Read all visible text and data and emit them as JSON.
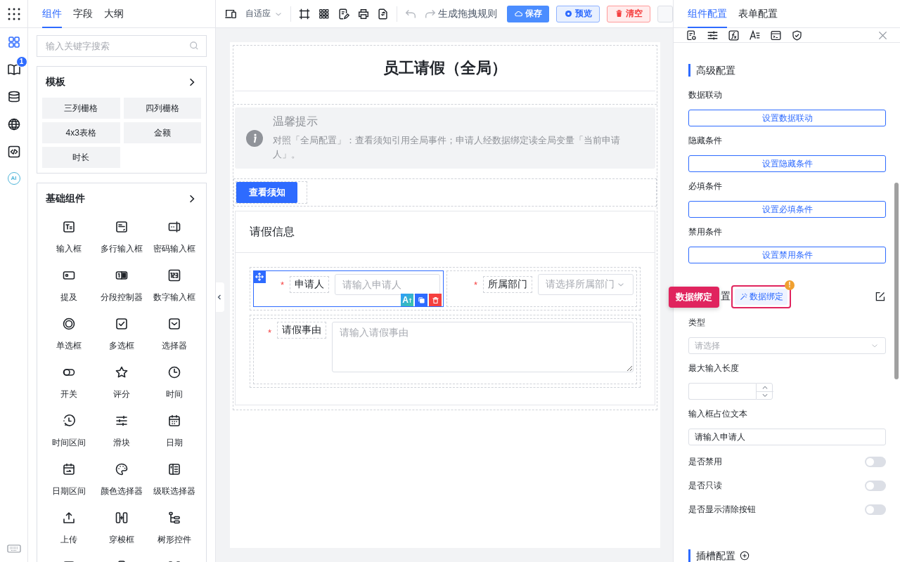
{
  "rail": {
    "items": [
      {
        "kind": "grid",
        "selected": true
      },
      {
        "kind": "book",
        "selected": false,
        "badge": "1"
      },
      {
        "kind": "database",
        "selected": false
      },
      {
        "kind": "globe",
        "selected": false
      },
      {
        "kind": "code",
        "selected": false
      },
      {
        "kind": "ai",
        "selected": false,
        "text": "AI"
      }
    ]
  },
  "left_panel": {
    "tabs": [
      {
        "label": "组件",
        "selected": true
      },
      {
        "label": "字段",
        "selected": false
      },
      {
        "label": "大纲",
        "selected": false
      }
    ],
    "search": {
      "placeholder": "输入关键字搜索"
    },
    "templates": {
      "title": "模板",
      "items": [
        "三列栅格",
        "四列栅格",
        "4x3表格",
        "金额",
        "时长"
      ]
    },
    "basic": {
      "title": "基础组件",
      "items": [
        {
          "label": "输入框",
          "kind": "input"
        },
        {
          "label": "多行输入框",
          "kind": "textarea"
        },
        {
          "label": "密码输入框",
          "kind": "password"
        },
        {
          "label": "提及",
          "kind": "mention"
        },
        {
          "label": "分段控制器",
          "kind": "segmented"
        },
        {
          "label": "数字输入框",
          "kind": "number"
        },
        {
          "label": "单选框",
          "kind": "radio"
        },
        {
          "label": "多选框",
          "kind": "checkbox"
        },
        {
          "label": "选择器",
          "kind": "select"
        },
        {
          "label": "开关",
          "kind": "switch"
        },
        {
          "label": "评分",
          "kind": "rate"
        },
        {
          "label": "时间",
          "kind": "time"
        },
        {
          "label": "时间区间",
          "kind": "timerange"
        },
        {
          "label": "滑块",
          "kind": "slider"
        },
        {
          "label": "日期",
          "kind": "date"
        },
        {
          "label": "日期区间",
          "kind": "daterange"
        },
        {
          "label": "颜色选择器",
          "kind": "palette"
        },
        {
          "label": "级联选择器",
          "kind": "cascader"
        },
        {
          "label": "上传",
          "kind": "upload"
        },
        {
          "label": "穿梭框",
          "kind": "transfer"
        },
        {
          "label": "树形控件",
          "kind": "tree"
        },
        {
          "kind": "image"
        },
        {
          "kind": "phone"
        },
        {
          "kind": "scan"
        }
      ]
    }
  },
  "toolbar": {
    "device": "自适应",
    "rule": "生成拖拽规则",
    "buttons": [
      {
        "kind": "save",
        "label": "保存"
      },
      {
        "kind": "preview",
        "label": "预览"
      },
      {
        "kind": "clear",
        "label": "清空"
      }
    ]
  },
  "form": {
    "title": "员工请假（全局）",
    "tip": {
      "title": "温馨提示",
      "text": "对照「全局配置」：查看须知引用全局事件；申请人经数据绑定读全局变量「当前申请人」。"
    },
    "button": "查看须知",
    "section": "请假信息",
    "ai_action": "A",
    "rows": [
      [
        {
          "kind": "input",
          "label": "申请人",
          "placeholder": "请输入申请人",
          "required_mark": "*",
          "selected": true
        },
        {
          "kind": "select",
          "label": "所属部门",
          "placeholder": "请选择所属部门",
          "required_mark": "*",
          "selected": false
        }
      ],
      [
        {
          "kind": "textarea",
          "label": "请假事由",
          "placeholder": "请输入请假事由",
          "required_mark": "*",
          "selected": false
        }
      ]
    ]
  },
  "right_panel": {
    "tabs": [
      {
        "label": "组件配置",
        "selected": true
      },
      {
        "label": "表单配置",
        "selected": false
      }
    ],
    "advanced": {
      "title": "高级配置",
      "items": [
        {
          "label": "数据联动",
          "button": "设置数据联动"
        },
        {
          "label": "隐藏条件",
          "button": "设置隐藏条件"
        },
        {
          "label": "必填条件",
          "button": "设置必填条件"
        },
        {
          "label": "禁用条件",
          "button": "设置禁用条件"
        }
      ]
    },
    "callout": "数据绑定",
    "heading_tail": "置",
    "binding_button": "数据绑定",
    "binding_badge": "!",
    "props": [
      {
        "kind": "select",
        "label": "类型",
        "placeholder": "请选择"
      },
      {
        "kind": "number",
        "label": "最大输入长度"
      },
      {
        "kind": "text",
        "label": "输入框占位文本",
        "value": "请输入申请人"
      },
      {
        "kind": "switch",
        "label": "是否禁用",
        "on": false
      },
      {
        "kind": "switch",
        "label": "是否只读",
        "on": false
      },
      {
        "kind": "switch",
        "label": "是否显示清除按钮",
        "on": false
      }
    ],
    "slot": {
      "title": "插槽配置"
    }
  }
}
